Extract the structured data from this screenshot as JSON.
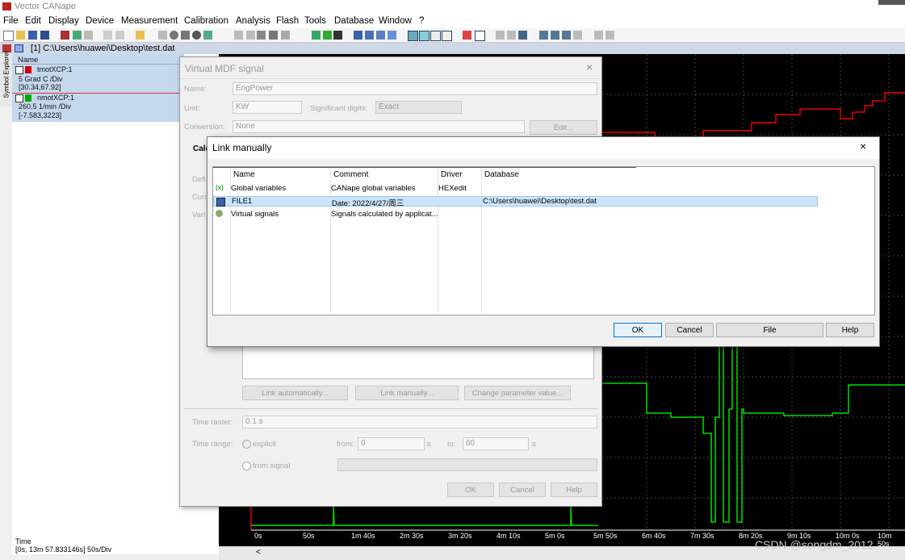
{
  "app": {
    "title": "Vector CANape"
  },
  "menu": [
    "File",
    "Edit",
    "Display",
    "Device",
    "Measurement",
    "Calibration",
    "Analysis",
    "Flash",
    "Tools",
    "Database",
    "Window",
    "?"
  ],
  "doc": {
    "title": "[1] C:\\Users\\huawei\\Desktop\\test.dat"
  },
  "symbol_explorer": {
    "tab_label": "Symbol Explorer"
  },
  "legend": {
    "header": "Name",
    "signals": [
      {
        "name": "tmotXCP:1",
        "scale": "5 Grad C /Div",
        "range": "[30.34,67.92]",
        "color": "#cc0000"
      },
      {
        "name": "nmotXCP:1",
        "scale": "260.5 1/min /Div",
        "range": "[-7.583,3223]",
        "color": "#00aa00"
      }
    ]
  },
  "status": {
    "time_label": "Time",
    "time_value": "[0s, 13m 57.833146s] 50s/Div"
  },
  "plot": {
    "time_ticks": [
      "0s",
      "50s",
      "1m 40s",
      "2m 30s",
      "3m 20s",
      "4m 10s",
      "5m 0s",
      "5m 50s",
      "6m 40s",
      "7m 30s",
      "8m 20s",
      "9m 10s",
      "10m 0s",
      "10m 50s"
    ]
  },
  "scroll": {
    "left_arrow": "<"
  },
  "virtual_mdf": {
    "title": "Virtual MDF signal",
    "close": "×",
    "name_label": "Name:",
    "name_value": "EngPower",
    "unit_label": "Unit:",
    "unit_value": "KW",
    "sig_digits_label": "Significant digits:",
    "sig_digits_value": "Exact",
    "conversion_label": "Conversion:",
    "conversion_value": "None",
    "edit_button": "Edit...",
    "tab_label": "Calc",
    "side_labels": [
      "Defi",
      "Curr",
      "Vari"
    ],
    "link_auto": "Link automatically...",
    "link_manual": "Link manually...",
    "change_param": "Change parameter value...",
    "time_raster_label": "Time raster:",
    "time_raster_value": "0.1 s",
    "time_range_label": "Time range:",
    "explicit_label": "explicit",
    "from_label": "from:",
    "from_value": "0",
    "from_unit": "s",
    "to_label": "to:",
    "to_value": "60",
    "to_unit": "s",
    "from_signal_label": "from signal",
    "ok": "OK",
    "cancel": "Cancel",
    "help": "Help"
  },
  "link_manually": {
    "title": "Link manually",
    "close": "×",
    "columns": [
      "Name",
      "Comment",
      "Driver",
      "Database"
    ],
    "rows": [
      {
        "icon": "global-variables-icon",
        "name": "Global variables",
        "comment": "CANape global variables",
        "driver": "HEXedit",
        "database": ""
      },
      {
        "icon": "file-icon",
        "name": "FILE1",
        "comment": "Date: 2022/4/27/周三",
        "driver": "",
        "database": "C:\\Users\\huawei\\Desktop\\test.dat"
      },
      {
        "icon": "virtual-signals-icon",
        "name": "Virtual signals",
        "comment": "Signals calculated by applicat...",
        "driver": "",
        "database": ""
      }
    ],
    "ok": "OK",
    "cancel": "Cancel",
    "file": "File",
    "help": "Help"
  },
  "watermark": "CSDN @songdm_2012"
}
